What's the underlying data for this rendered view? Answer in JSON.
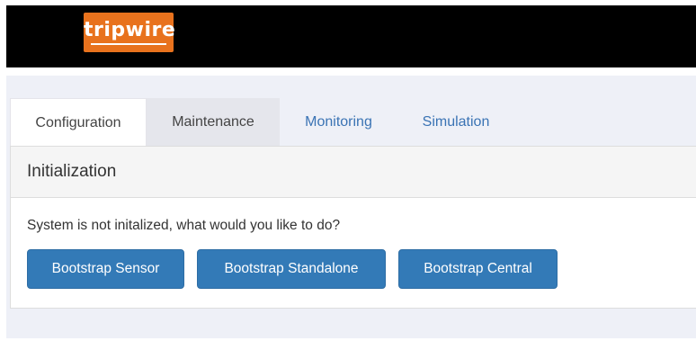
{
  "header": {
    "logo_text": "tripwire"
  },
  "tabs": [
    {
      "label": "Configuration",
      "state": "active"
    },
    {
      "label": "Maintenance",
      "state": "hover"
    },
    {
      "label": "Monitoring",
      "state": "normal"
    },
    {
      "label": "Simulation",
      "state": "normal"
    }
  ],
  "panel": {
    "heading": "Initialization",
    "message": "System is not initalized, what would you like to do?",
    "buttons": [
      "Bootstrap Sensor",
      "Bootstrap Standalone",
      "Bootstrap Central"
    ]
  },
  "colors": {
    "logo": "#e8721d",
    "button": "#337ab7",
    "tab_link": "#3a73b4",
    "background": "#eef0f7"
  }
}
